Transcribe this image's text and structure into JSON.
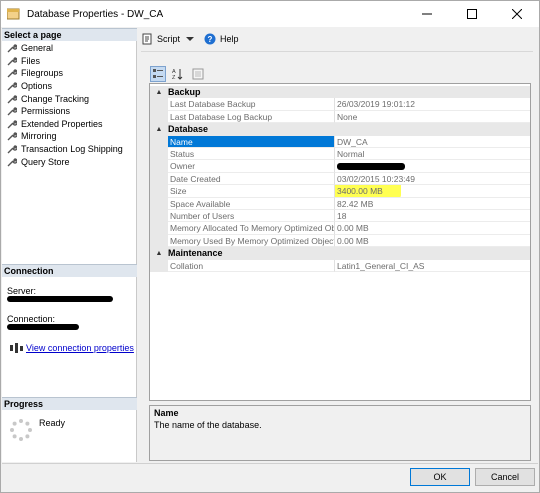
{
  "window": {
    "title": "Database Properties - DW_CA",
    "controls": [
      "minimize",
      "maximize",
      "close"
    ]
  },
  "left_pane": {
    "select_page_header": "Select a page",
    "pages": [
      "General",
      "Files",
      "Filegroups",
      "Options",
      "Change Tracking",
      "Permissions",
      "Extended Properties",
      "Mirroring",
      "Transaction Log Shipping",
      "Query Store"
    ],
    "connection_header": "Connection",
    "server_label": "Server:",
    "connection_label": "Connection:",
    "view_connection_link": "View connection properties",
    "progress_header": "Progress",
    "progress_status": "Ready"
  },
  "toolbar": {
    "script_label": "Script",
    "help_label": "Help"
  },
  "grid": {
    "categories": [
      {
        "name": "Backup",
        "properties": [
          {
            "name": "Last Database Backup",
            "value": "26/03/2019 19:01:12"
          },
          {
            "name": "Last Database Log Backup",
            "value": "None"
          }
        ]
      },
      {
        "name": "Database",
        "properties": [
          {
            "name": "Name",
            "value": "DW_CA",
            "selected": true
          },
          {
            "name": "Status",
            "value": "Normal"
          },
          {
            "name": "Owner",
            "value": "",
            "redacted": true
          },
          {
            "name": "Date Created",
            "value": "03/02/2015 10:23:49"
          },
          {
            "name": "Size",
            "value": "3400.00 MB",
            "highlighted": true
          },
          {
            "name": "Space Available",
            "value": "82.42 MB"
          },
          {
            "name": "Number of Users",
            "value": "18"
          },
          {
            "name": "Memory Allocated To Memory Optimized Obj",
            "value": "0.00 MB"
          },
          {
            "name": "Memory Used By Memory Optimized Objects",
            "value": "0.00 MB"
          }
        ]
      },
      {
        "name": "Maintenance",
        "properties": [
          {
            "name": "Collation",
            "value": "Latin1_General_CI_AS"
          }
        ]
      }
    ]
  },
  "description": {
    "title": "Name",
    "text": "The name of the database."
  },
  "buttons": {
    "ok": "OK",
    "cancel": "Cancel"
  },
  "colors": {
    "selection": "#0078d7",
    "highlight": "#ffff33",
    "link": "#0000cc"
  }
}
